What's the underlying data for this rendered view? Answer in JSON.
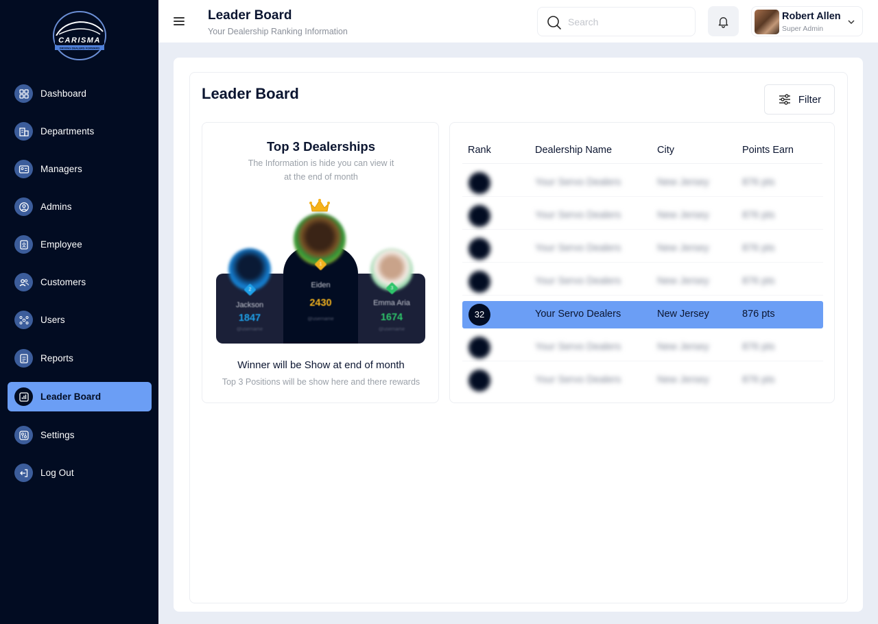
{
  "brand": {
    "name": "CARISMA",
    "tagline": "DRIVING DEALERS FORWARD"
  },
  "sidebar": {
    "items": [
      {
        "label": "Dashboard",
        "icon": "dashboard-icon",
        "active": false
      },
      {
        "label": "Departments",
        "icon": "building-icon",
        "active": false
      },
      {
        "label": "Managers",
        "icon": "id-card-icon",
        "active": false
      },
      {
        "label": "Admins",
        "icon": "user-circle-icon",
        "active": false
      },
      {
        "label": "Employee",
        "icon": "badge-icon",
        "active": false
      },
      {
        "label": "Customers",
        "icon": "users-icon",
        "active": false
      },
      {
        "label": "Users",
        "icon": "network-icon",
        "active": false
      },
      {
        "label": "Reports",
        "icon": "report-icon",
        "active": false
      },
      {
        "label": "Leader Board",
        "icon": "chart-icon",
        "active": true
      },
      {
        "label": "Settings",
        "icon": "settings-icon",
        "active": false
      },
      {
        "label": "Log Out",
        "icon": "logout-icon",
        "active": false
      }
    ]
  },
  "header": {
    "title": "Leader Board",
    "subtitle": "Your Dealership Ranking Information",
    "search_placeholder": "Search",
    "user": {
      "name": "Robert Allen",
      "role": "Super Admin"
    }
  },
  "main": {
    "title": "Leader Board",
    "filter_label": "Filter",
    "top3": {
      "title": "Top 3 Dealerships",
      "description": "The Information is hide you can view it at the end of month",
      "podium": [
        {
          "position": "2",
          "name": "Jackson",
          "score": "1847",
          "username": "@username",
          "color": "#1ea0e8"
        },
        {
          "position": "1",
          "name": "Eiden",
          "score": "2430",
          "username": "@username",
          "color": "#f2b21e"
        },
        {
          "position": "3",
          "name": "Emma Aria",
          "score": "1674",
          "username": "@username",
          "color": "#2ec46a"
        }
      ],
      "winner_text": "Winner will be Show at end of month",
      "winner_sub": "Top 3 Positions will be show here and there rewards"
    },
    "table": {
      "columns": [
        "Rank",
        "Dealership Name",
        "City",
        "Points Earn"
      ],
      "rows": [
        {
          "rank": "",
          "name": "Your Servo Dealers",
          "city": "New Jersey",
          "points": "876 pts",
          "blurred": true
        },
        {
          "rank": "",
          "name": "Your Servo Dealers",
          "city": "New Jersey",
          "points": "876 pts",
          "blurred": true
        },
        {
          "rank": "",
          "name": "Your Servo Dealers",
          "city": "New Jersey",
          "points": "876 pts",
          "blurred": true
        },
        {
          "rank": "",
          "name": "Your Servo Dealers",
          "city": "New Jersey",
          "points": "876 pts",
          "blurred": true
        },
        {
          "rank": "32",
          "name": "Your Servo Dealers",
          "city": "New Jersey",
          "points": "876 pts",
          "blurred": false
        },
        {
          "rank": "",
          "name": "Your Servo Dealers",
          "city": "New Jersey",
          "points": "876 pts",
          "blurred": true
        },
        {
          "rank": "",
          "name": "Your Servo Dealers",
          "city": "New Jersey",
          "points": "876 pts",
          "blurred": true
        }
      ]
    }
  },
  "colors": {
    "sidebar_bg": "#020c22",
    "accent": "#6b9ef5",
    "icon_bg": "#3c5d9b"
  }
}
